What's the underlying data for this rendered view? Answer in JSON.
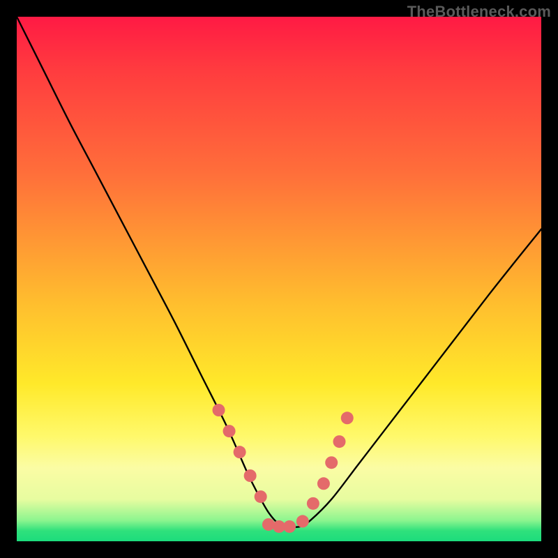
{
  "watermark": "TheBottleneck.com",
  "chart_data": {
    "type": "line",
    "title": "",
    "xlabel": "",
    "ylabel": "",
    "xlim": [
      0,
      100
    ],
    "ylim": [
      0,
      100
    ],
    "grid": false,
    "series": [
      {
        "name": "curve",
        "color": "#000000",
        "x": [
          0,
          5,
          10,
          15,
          20,
          25,
          30,
          35,
          40,
          44,
          46,
          48,
          50,
          52,
          54,
          56,
          60,
          65,
          70,
          75,
          80,
          85,
          90,
          95,
          100
        ],
        "y": [
          100,
          90,
          80,
          70.5,
          61,
          51.5,
          42,
          32,
          22,
          13,
          9,
          5.5,
          3.3,
          2.8,
          2.8,
          4,
          8,
          14.5,
          21,
          27.5,
          34,
          40.5,
          47,
          53.3,
          59.5
        ]
      }
    ],
    "markers": {
      "name": "highlight-points",
      "color": "#e46a6a",
      "radius_px": 9,
      "x": [
        38.5,
        40.5,
        42.5,
        44.5,
        46.5,
        48.0,
        50.0,
        52.0,
        54.5,
        56.5,
        58.5,
        60.0,
        61.5,
        63.0
      ],
      "y": [
        25.0,
        21.0,
        17.0,
        12.5,
        8.5,
        3.2,
        2.8,
        2.8,
        3.8,
        7.2,
        11.0,
        15.0,
        19.0,
        23.5
      ]
    },
    "colors": {
      "gradient_top": "#ff1a44",
      "gradient_mid": "#ffe92a",
      "gradient_bottom": "#1cdc7c",
      "marker": "#e46a6a",
      "line": "#000000",
      "frame": "#000000"
    }
  }
}
